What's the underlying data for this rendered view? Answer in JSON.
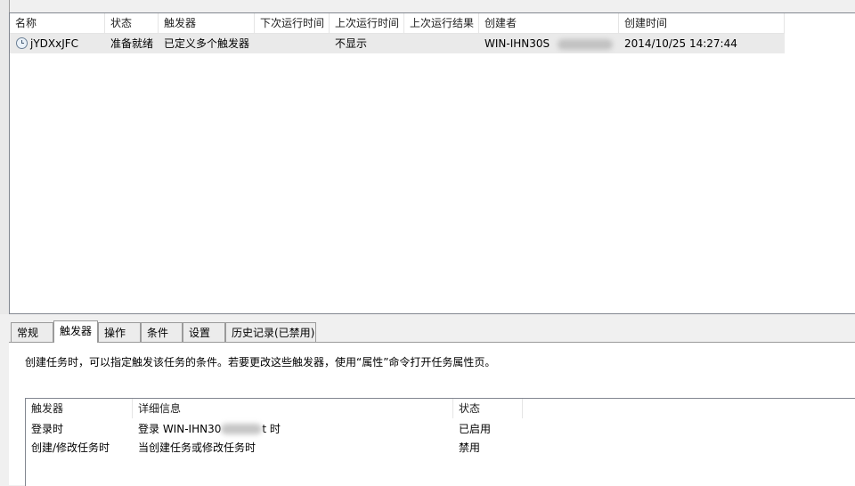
{
  "task_list": {
    "columns": [
      "名称",
      "状态",
      "触发器",
      "下次运行时间",
      "上次运行时间",
      "上次运行结果",
      "创建者",
      "创建时间"
    ],
    "rows": [
      {
        "icon": "clock-icon",
        "name": "jYDXxJFC",
        "status": "准备就绪",
        "triggers": "已定义多个触发器",
        "next_run": "",
        "last_run": "不显示",
        "last_result": "",
        "author": "WIN-IHN30S",
        "created": "2014/10/25 14:27:44"
      }
    ]
  },
  "tabs": [
    "常规",
    "触发器",
    "操作",
    "条件",
    "设置",
    "历史记录(已禁用)"
  ],
  "active_tab": "触发器",
  "triggers_panel": {
    "description": "创建任务时，可以指定触发该任务的条件。若要更改这些触发器，使用“属性”命令打开任务属性页。",
    "columns": [
      "触发器",
      "详细信息",
      "状态"
    ],
    "rows": [
      {
        "trigger": "登录时",
        "details_prefix": "登录 WIN-IHN30",
        "details_suffix": "t 时",
        "status": "已启用"
      },
      {
        "trigger": "创建/修改任务时",
        "details_prefix": "当创建任务或修改任务时",
        "details_suffix": "",
        "status": "禁用"
      }
    ]
  }
}
